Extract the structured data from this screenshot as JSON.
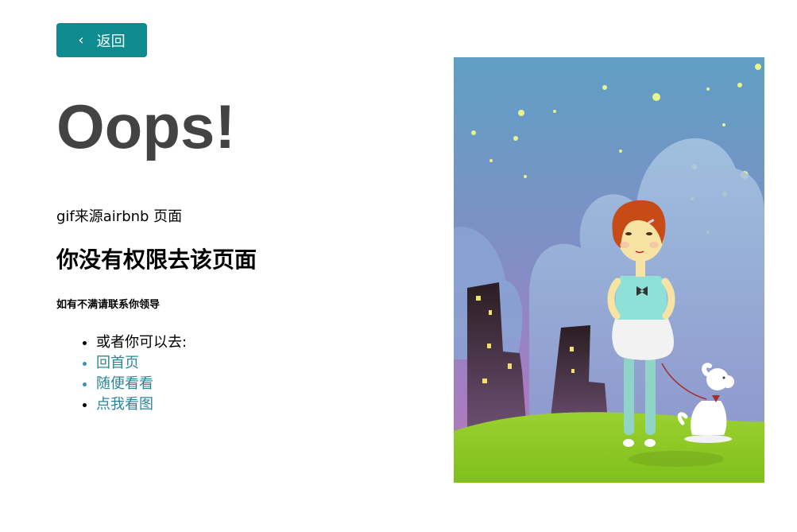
{
  "back_button": {
    "label": "返回"
  },
  "heading": "Oops!",
  "gif_source": "gif来源airbnb 页面",
  "no_permission": "你没有权限去该页面",
  "contact_note": "如有不满请联系你领导",
  "options": {
    "intro": "或者你可以去:",
    "links": [
      "回首页",
      "随便看看",
      "点我看图"
    ]
  },
  "colors": {
    "accent": "#0f8a8f",
    "heading": "#434343",
    "link": "#2b8598"
  }
}
